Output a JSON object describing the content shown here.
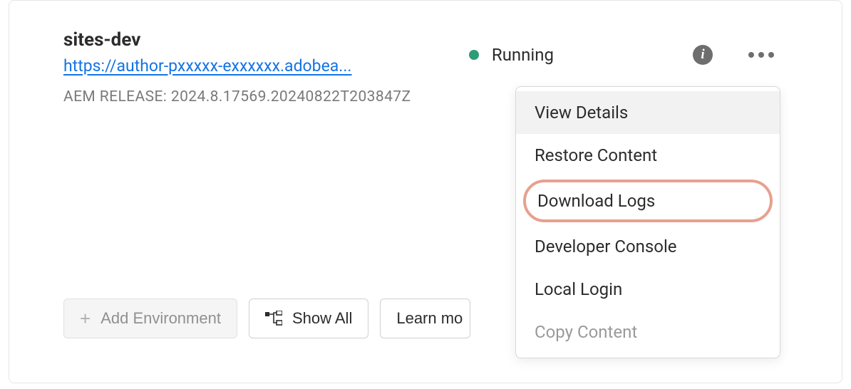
{
  "env": {
    "title": "sites-dev",
    "url": "https://author-pxxxxx-exxxxxx.adobea...",
    "release": "AEM RELEASE: 2024.8.17569.20240822T203847Z"
  },
  "status": {
    "text": "Running",
    "color": "#2d9d78"
  },
  "buttons": {
    "add_env": "Add Environment",
    "show_all": "Show All",
    "learn_more": "Learn mo"
  },
  "dropdown": {
    "items": [
      {
        "label": "View Details",
        "hover": true
      },
      {
        "label": "Restore Content"
      },
      {
        "label": "Download Logs",
        "highlight": true
      },
      {
        "label": "Developer Console"
      },
      {
        "label": "Local Login"
      },
      {
        "label": "Copy Content",
        "disabled": true
      }
    ]
  }
}
